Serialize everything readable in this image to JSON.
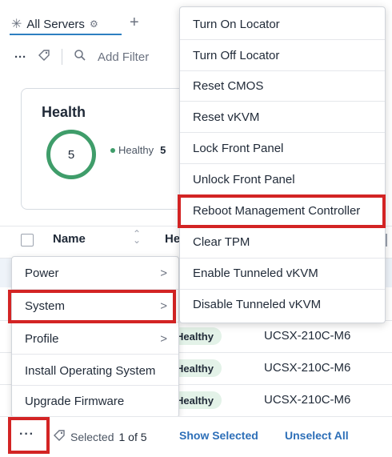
{
  "tabs": {
    "active_label": "All Servers",
    "add_label": "+"
  },
  "toolbar": {
    "more_label": "···",
    "filter_placeholder": "Add Filter"
  },
  "health_card": {
    "title": "Health",
    "total": "5",
    "legend_label": "Healthy",
    "legend_count": "5"
  },
  "table": {
    "headers": {
      "name": "Name",
      "health_partial": "He"
    },
    "rows": [
      {
        "status": "Healthy",
        "model": "UCSX-210C-M6"
      },
      {
        "status": "Healthy",
        "model": "UCSX-210C-M6"
      },
      {
        "status": "Healthy",
        "model": "UCSX-210C-M6"
      }
    ]
  },
  "actions_menu": {
    "items": [
      {
        "label": "Power",
        "chevron": ">"
      },
      {
        "label": "System",
        "chevron": ">"
      },
      {
        "label": "Profile",
        "chevron": ">"
      },
      {
        "label": "Install Operating System"
      },
      {
        "label": "Upgrade Firmware"
      }
    ]
  },
  "system_submenu": {
    "items": [
      "Turn On Locator",
      "Turn Off Locator",
      "Reset CMOS",
      "Reset vKVM",
      "Lock Front Panel",
      "Unlock Front Panel",
      "Reboot Management Controller",
      "Clear TPM",
      "Enable Tunneled vKVM",
      "Disable Tunneled vKVM"
    ]
  },
  "bottom_bar": {
    "more_label": "···",
    "selected_prefix": "Selected",
    "selected_count": "1 of 5",
    "show_selected": "Show Selected",
    "unselect_all": "Unselect All"
  },
  "colors": {
    "accent": "#2d7fc1",
    "link": "#2d6fb8",
    "healthy": "#3f9d6a",
    "highlight": "#d32424"
  }
}
